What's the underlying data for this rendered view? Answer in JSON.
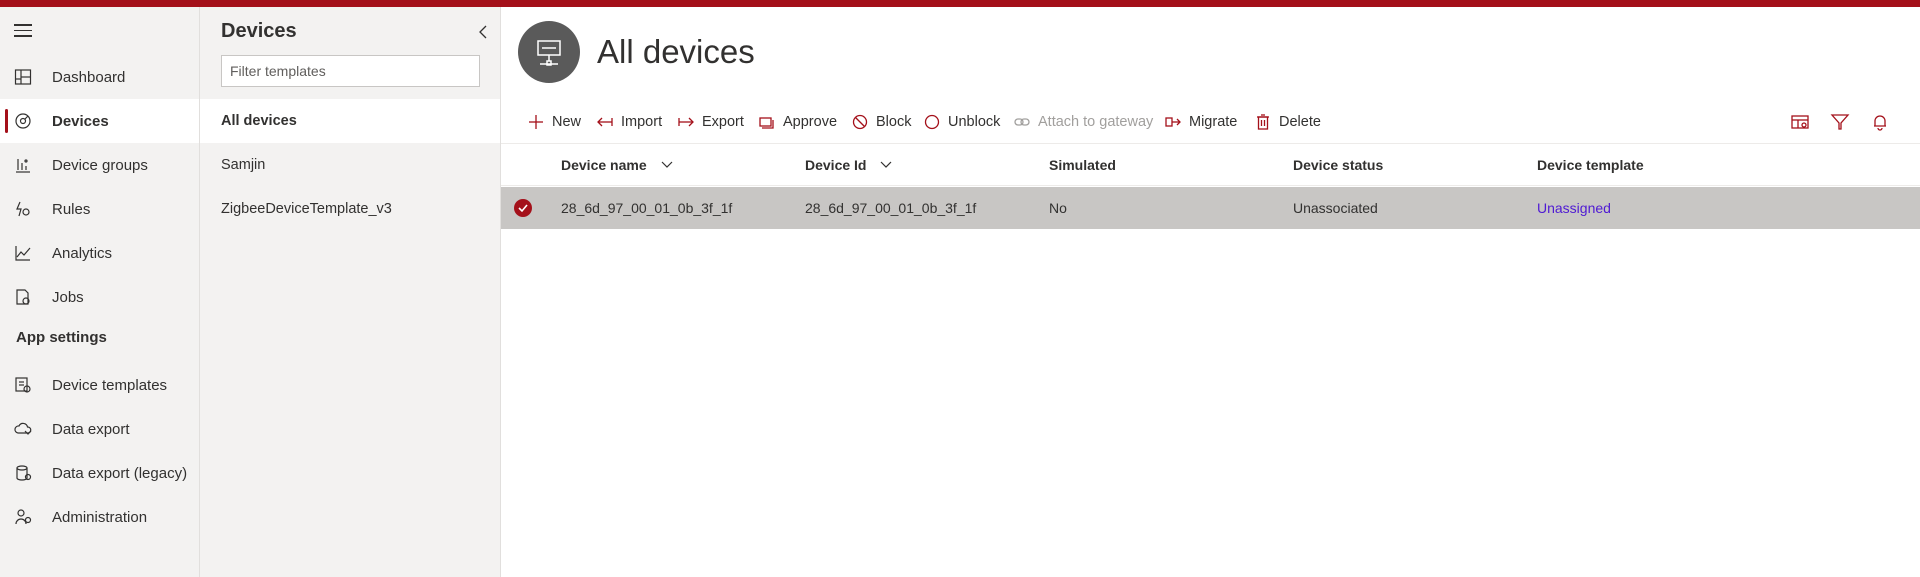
{
  "colors": {
    "accent": "#a4101a",
    "link": "#4f1ad3",
    "selected_row": "#c8c6c4",
    "nav_bg": "#f3f2f1"
  },
  "nav": {
    "items": [
      {
        "label": "Dashboard",
        "icon": "dashboard-icon"
      },
      {
        "label": "Devices",
        "icon": "devices-icon",
        "active": true
      },
      {
        "label": "Device groups",
        "icon": "device-groups-icon"
      },
      {
        "label": "Rules",
        "icon": "rules-icon"
      },
      {
        "label": "Analytics",
        "icon": "analytics-icon"
      },
      {
        "label": "Jobs",
        "icon": "jobs-icon"
      }
    ],
    "section": "App settings",
    "settings_items": [
      {
        "label": "Device templates",
        "icon": "device-templates-icon"
      },
      {
        "label": "Data export",
        "icon": "data-export-icon"
      },
      {
        "label": "Data export (legacy)",
        "icon": "data-export-legacy-icon"
      },
      {
        "label": "Administration",
        "icon": "administration-icon"
      }
    ]
  },
  "templates_panel": {
    "title": "Devices",
    "filter_placeholder": "Filter templates",
    "items": [
      "All devices",
      "Samjin",
      "ZigbeeDeviceTemplate_v3"
    ]
  },
  "main": {
    "title": "All devices",
    "commands": {
      "new": "New",
      "import": "Import",
      "export": "Export",
      "approve": "Approve",
      "block": "Block",
      "unblock": "Unblock",
      "attach": "Attach to gateway",
      "migrate": "Migrate",
      "delete": "Delete"
    },
    "table": {
      "columns": [
        "Device name",
        "Device Id",
        "Simulated",
        "Device status",
        "Device template"
      ],
      "rows": [
        {
          "device_name": "28_6d_97_00_01_0b_3f_1f",
          "device_id": "28_6d_97_00_01_0b_3f_1f",
          "simulated": "No",
          "status": "Unassociated",
          "template": "Unassigned",
          "selected": true
        }
      ]
    }
  }
}
